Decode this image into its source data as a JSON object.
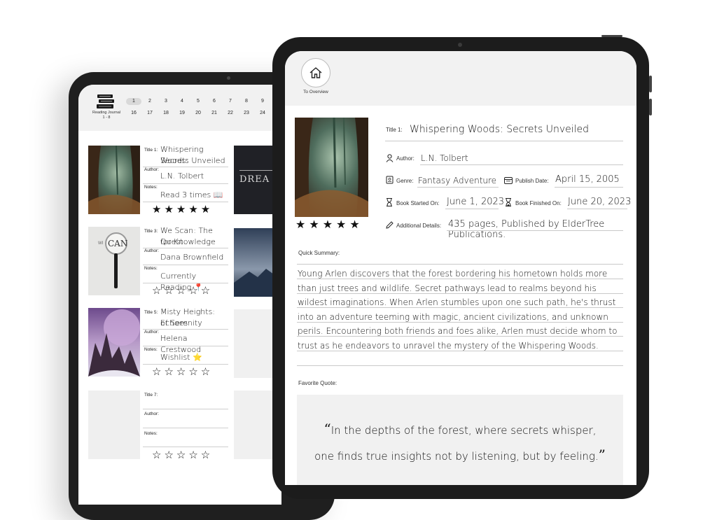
{
  "left_app": {
    "header": {
      "journal_label_line1": "Reading Journal",
      "journal_label_line2": "1 - 8",
      "page_row1": [
        "1",
        "2",
        "3",
        "4",
        "5",
        "6",
        "7",
        "8",
        "9"
      ],
      "page_row2": [
        "16",
        "17",
        "18",
        "19",
        "20",
        "21",
        "22",
        "23",
        "24"
      ],
      "active_page": "1"
    },
    "books": [
      {
        "title_label": "Title 1:",
        "title_line1": "Whispering Woods:",
        "title_line2": "Secrets Unveiled",
        "author_label": "Author:",
        "author": "L.N. Tolbert",
        "notes_label": "Notes:",
        "notes": "Read 3 times 📖",
        "stars": "★★★★★",
        "filled": 5
      },
      {
        "title_label": "Title 3:",
        "title_line1": "We Scan: The Quest",
        "title_line2": "for Knowledge",
        "author_label": "Author:",
        "author": "Dana Brownfield",
        "notes_label": "Notes:",
        "notes": "Currently Reading 📍",
        "stars": "☆☆☆☆☆",
        "filled": 0
      },
      {
        "title_label": "Title 5:",
        "title_line1": "Misty Heights: Echoes",
        "title_line2": "of Serenity",
        "author_label": "Author:",
        "author": "Helena Crestwood",
        "notes_label": "Notes:",
        "notes": "Wishlist ⭐",
        "stars": "☆☆☆☆☆",
        "filled": 0
      },
      {
        "title_label": "Title 7:",
        "title_line1": "",
        "title_line2": "",
        "author_label": "Author:",
        "author": "",
        "notes_label": "Notes:",
        "notes": "",
        "stars": "☆☆☆☆☆",
        "filled": 0
      }
    ],
    "side_cover_text": "DREA",
    "magnifier_text_small": "WI",
    "magnifier_text_big": "CAN"
  },
  "right_app": {
    "home_label": "To Overview",
    "title_label": "Title 1:",
    "title": "Whispering Woods: Secrets Unveiled",
    "author_label": "Author:",
    "author": "L.N. Tolbert",
    "genre_label": "Genre:",
    "genre": "Fantasy Adventure",
    "publish_label": "Publish Date:",
    "publish_date": "April 15, 2005",
    "started_label": "Book Started On:",
    "started": "June 1, 2023",
    "finished_label": "Book Finished On:",
    "finished": "June 20, 2023",
    "details_label": "Additional Details:",
    "details": "435 pages, Published by ElderTree Publications.",
    "rating_stars": "★★★★★",
    "summary_label": "Quick Summary:",
    "summary": "Young Arlen discovers that the forest bordering his hometown holds more than just trees and wildlife. Secret pathways lead to realms beyond his wildest imaginations. When Arlen stumbles upon one such path, he's thrust into an adventure teeming with magic, ancient civilizations, and unknown perils. Encountering both friends and foes alike, Arlen must decide whom to trust as he endeavors to unravel the mystery of the Whispering Woods.",
    "quote_label": "Favorite Quote:",
    "quote_line1": "In the depths of the forest, where secrets whisper,",
    "quote_line2": "one finds true insights not by listening, but by feeling.",
    "quote_open": "“",
    "quote_close": "”"
  }
}
